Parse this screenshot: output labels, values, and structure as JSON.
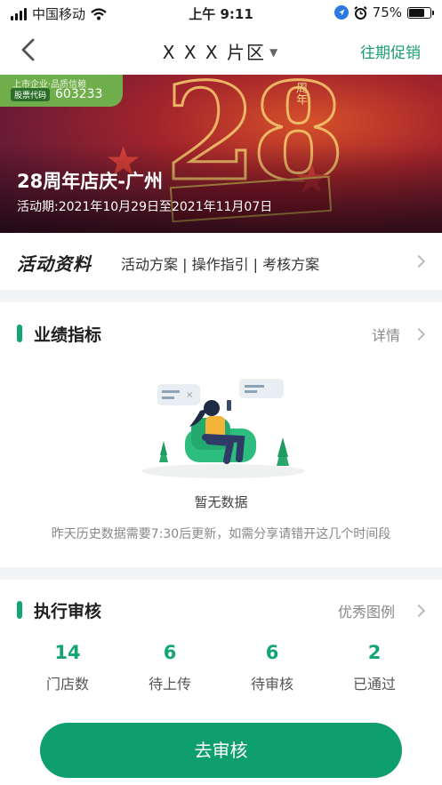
{
  "status_bar": {
    "carrier": "中国移动",
    "time": "上午 9:11",
    "battery": "75%",
    "battery_level": 0.75
  },
  "nav": {
    "title": "X X X 片区",
    "right_link": "往期促销"
  },
  "banner": {
    "badge_line1": "上市企业·品质信赖",
    "badge_code_label": "股票代码",
    "badge_code": "603233",
    "big_number": "28",
    "zhou_label": "周年",
    "title": "28周年店庆-广州",
    "period": "活动期:2021年10月29日至2021年11月07日"
  },
  "materials": {
    "logo_part1": "活动",
    "logo_part2": "资料",
    "links": "活动方案 | 操作指引 | 考核方案"
  },
  "performance": {
    "title": "业绩指标",
    "detail_link": "详情",
    "empty_title": "暂无数据",
    "empty_note": "昨天历史数据需要7:30后更新，如需分享请错开这几个时间段"
  },
  "audit": {
    "title": "执行审核",
    "example_link": "优秀图例",
    "stats": [
      {
        "value": "14",
        "label": "门店数"
      },
      {
        "value": "6",
        "label": "待上传"
      },
      {
        "value": "6",
        "label": "待审核"
      },
      {
        "value": "2",
        "label": "已通过"
      }
    ],
    "button": "去审核"
  },
  "colors": {
    "accent_green": "#13a574",
    "button_green": "#0f9f6e",
    "link_green": "#1a9e6e"
  }
}
